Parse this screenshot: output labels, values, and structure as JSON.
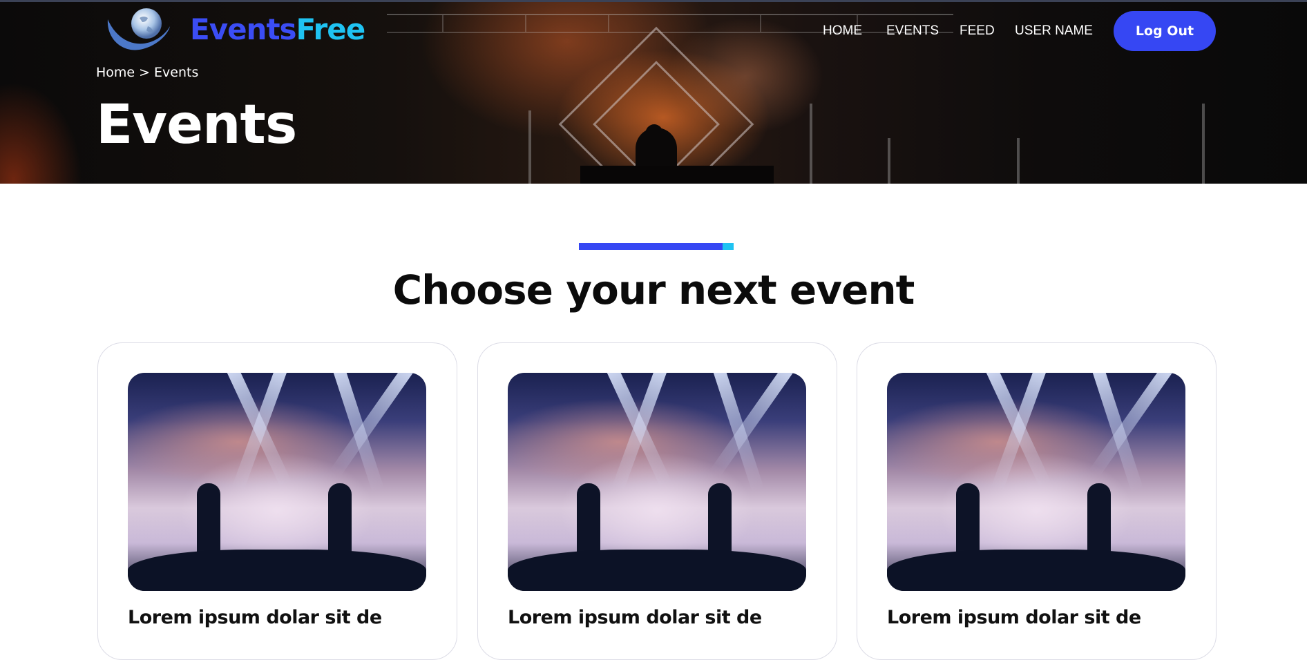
{
  "header": {
    "logo": {
      "part1": "Events",
      "part2": "Free",
      "icon": "globe-wave-icon"
    },
    "nav": [
      {
        "label": "HOME"
      },
      {
        "label": "EVENTS"
      },
      {
        "label": "FEED"
      },
      {
        "label": "USER NAME"
      }
    ],
    "logout_label": "Log Out"
  },
  "breadcrumb": {
    "home": "Home",
    "separator": ">",
    "current": "Events"
  },
  "hero": {
    "title": "Events"
  },
  "section": {
    "title": "Choose your next event"
  },
  "cards": [
    {
      "title": "Lorem ipsum dolar sit de"
    },
    {
      "title": "Lorem ipsum dolar sit de"
    },
    {
      "title": "Lorem ipsum dolar sit de"
    }
  ],
  "colors": {
    "primary": "#3647f3",
    "secondary": "#1fc3f2",
    "text": "#0b0b0b"
  }
}
